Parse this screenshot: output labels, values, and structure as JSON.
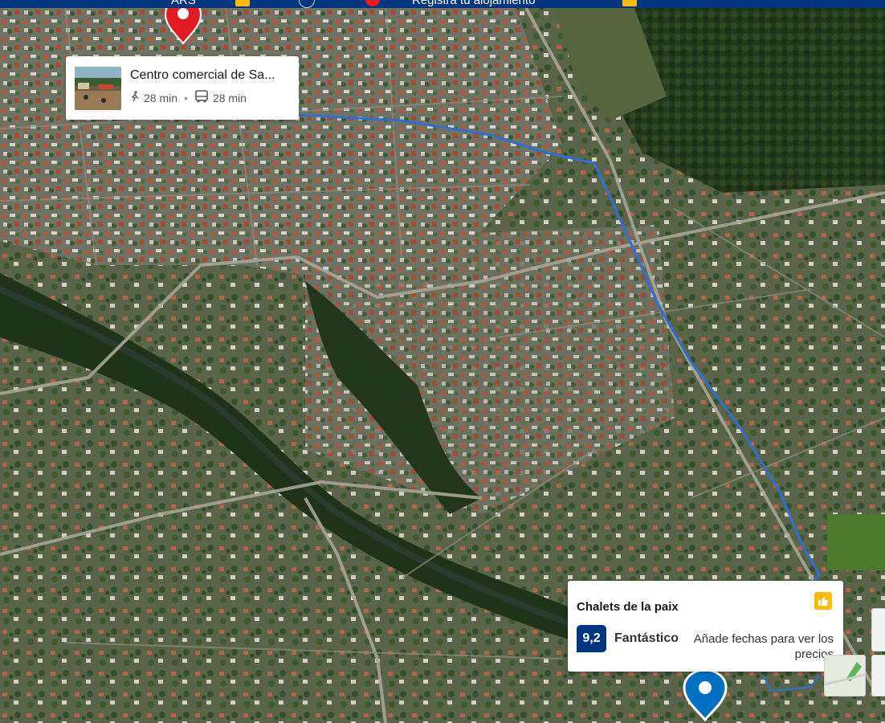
{
  "topbar": {
    "currency": "ARS",
    "help": "?",
    "register": "Registra tu alojamiento"
  },
  "origin_card": {
    "title": "Centro comercial de Sa...",
    "walk_time": "28 min",
    "bus_time": "28 min"
  },
  "hotel_card": {
    "name": "Chalets de la paix",
    "score": "9,2",
    "score_word": "Fantástico",
    "prices_hint": "Añade fechas para ver los precios"
  },
  "icons": {
    "walk": "walking-person-icon",
    "bus": "bus-icon",
    "thumbs": "thumbs-up-icon",
    "origin_pin": "map-pin-red-icon",
    "hotel_pin": "map-pin-blue-icon"
  },
  "colors": {
    "route": "#2f6fd1",
    "brand_blue": "#003580",
    "brand_yellow": "#febb02",
    "pin_red": "#e31b23",
    "pin_blue": "#0071c2"
  }
}
